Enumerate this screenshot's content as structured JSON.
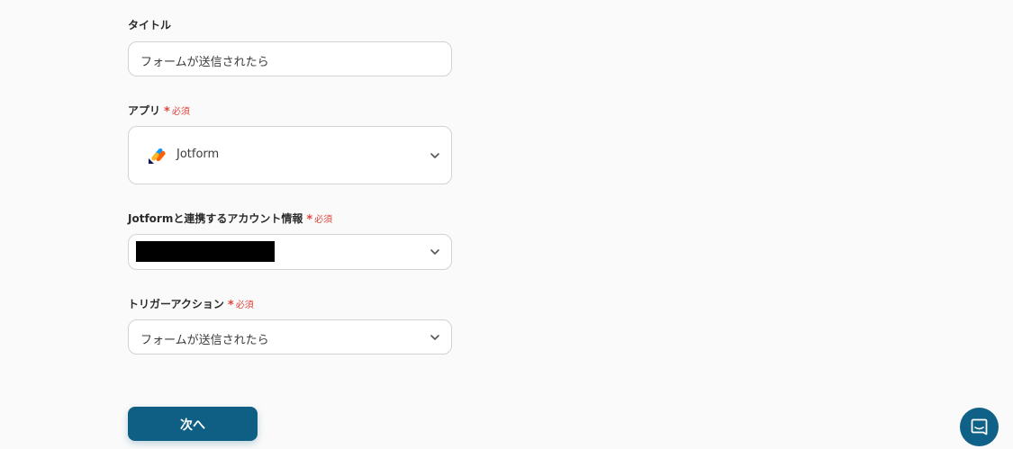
{
  "form": {
    "title": {
      "label": "タイトル",
      "value": "フォームが送信されたら"
    },
    "app": {
      "label": "アプリ",
      "required": "必須",
      "required_mark": "*",
      "value": "Jotform",
      "icon": "jotform-logo-icon"
    },
    "account": {
      "label": "Jotformと連携するアカウント情報",
      "required": "必須",
      "required_mark": "*",
      "value_redacted": true
    },
    "trigger": {
      "label": "トリガーアクション",
      "required": "必須",
      "required_mark": "*",
      "value": "フォームが送信されたら"
    }
  },
  "actions": {
    "next_label": "次へ"
  },
  "colors": {
    "background": "#fafafa",
    "primary": "#0f5f84",
    "required": "#e0463f",
    "border": "#cfd3d8"
  },
  "icons": {
    "chevron": "chevron-down-icon",
    "chat": "chat-support-icon"
  }
}
